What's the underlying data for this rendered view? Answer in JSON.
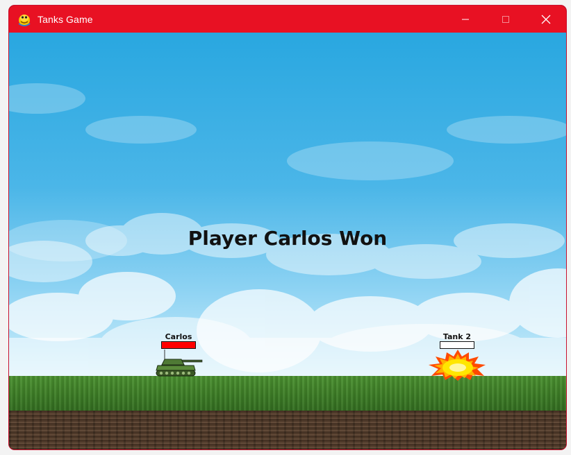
{
  "window": {
    "title": "Tanks Game",
    "app_icon": "pygame-snake-icon",
    "controls": {
      "minimize_icon": "minimize-icon",
      "maximize_icon": "maximize-icon",
      "close_icon": "close-icon"
    },
    "titlebar_color": "#e81123"
  },
  "game": {
    "message": "Player Carlos Won",
    "players": [
      {
        "name": "Carlos",
        "health": 1.0,
        "health_color": "#ff0000",
        "state": "alive"
      },
      {
        "name": "Tank 2",
        "health": 0.0,
        "health_color": "#ff0000",
        "state": "exploded"
      }
    ],
    "terrain": [
      "sky-with-clouds",
      "grass",
      "dirt"
    ]
  }
}
